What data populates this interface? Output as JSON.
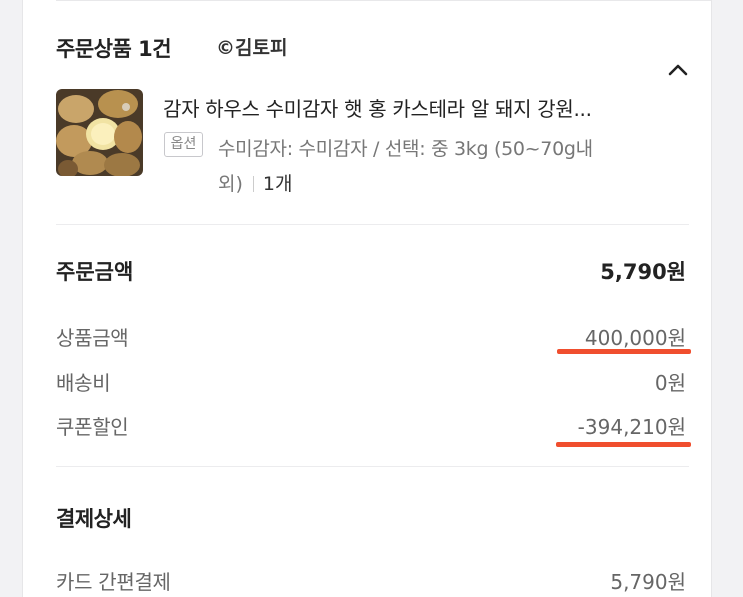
{
  "order_products": {
    "title": "주문상품 1건",
    "watermark": "©김토피",
    "product": {
      "name": "감자 하우스 수미감자 햇 홍 카스테라 알 돼지 강원...",
      "option_badge": "옵션",
      "option_text_line1": "수미감자: 수미감자 / 선택: 중 3kg (50~70g내",
      "option_text_line2": "외)",
      "quantity": "1개"
    }
  },
  "order_amount": {
    "title": "주문금액",
    "total": "5,790원",
    "rows": [
      {
        "label": "상품금액",
        "value": "400,000원"
      },
      {
        "label": "배송비",
        "value": "0원"
      },
      {
        "label": "쿠폰할인",
        "value": "-394,210원"
      }
    ]
  },
  "payment_details": {
    "title": "결제상세",
    "rows": [
      {
        "label": "카드 간편결제",
        "value": "5,790원"
      }
    ]
  },
  "colors": {
    "highlight_underline": "#f04e2e"
  },
  "icons": {
    "collapse": "chevron-up-icon"
  }
}
